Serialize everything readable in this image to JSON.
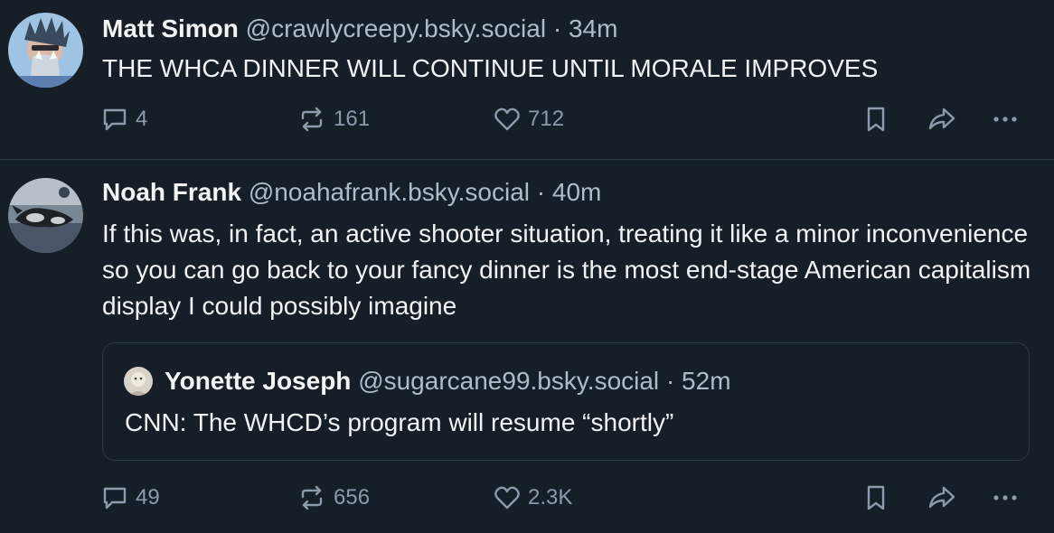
{
  "posts": [
    {
      "author": {
        "name": "Matt Simon",
        "handle": "@crawlycreepy.bsky.social"
      },
      "separator": "·",
      "time": "34m",
      "text": "THE WHCA DINNER WILL CONTINUE UNTIL MORALE IMPROVES",
      "stats": {
        "replies": "4",
        "reposts": "161",
        "likes": "712"
      }
    },
    {
      "author": {
        "name": "Noah Frank",
        "handle": "@noahafrank.bsky.social"
      },
      "separator": "·",
      "time": "40m",
      "text": "If this was, in fact, an active shooter situation, treating it like a minor inconvenience so you can go back to your fancy dinner is the most end-stage American capitalism display I could possibly imagine",
      "quote": {
        "author": {
          "name": "Yonette Joseph",
          "handle": "@sugarcane99.bsky.social"
        },
        "separator": "·",
        "time": "52m",
        "text": "CNN: The WHCD’s program will resume “shortly”"
      },
      "stats": {
        "replies": "49",
        "reposts": "656",
        "likes": "2.3K"
      }
    }
  ],
  "icons": {
    "reply": "speech-bubble-icon",
    "repost": "repost-arrows-icon",
    "like": "heart-icon",
    "bookmark": "bookmark-icon",
    "share": "share-arrow-icon",
    "more": "ellipsis-icon"
  },
  "colors": {
    "background": "#161e27",
    "primary_text": "#f1f3f5",
    "secondary_text": "#aebbc9",
    "action_icons": "#8c9aab",
    "border": "#2e3a46"
  }
}
